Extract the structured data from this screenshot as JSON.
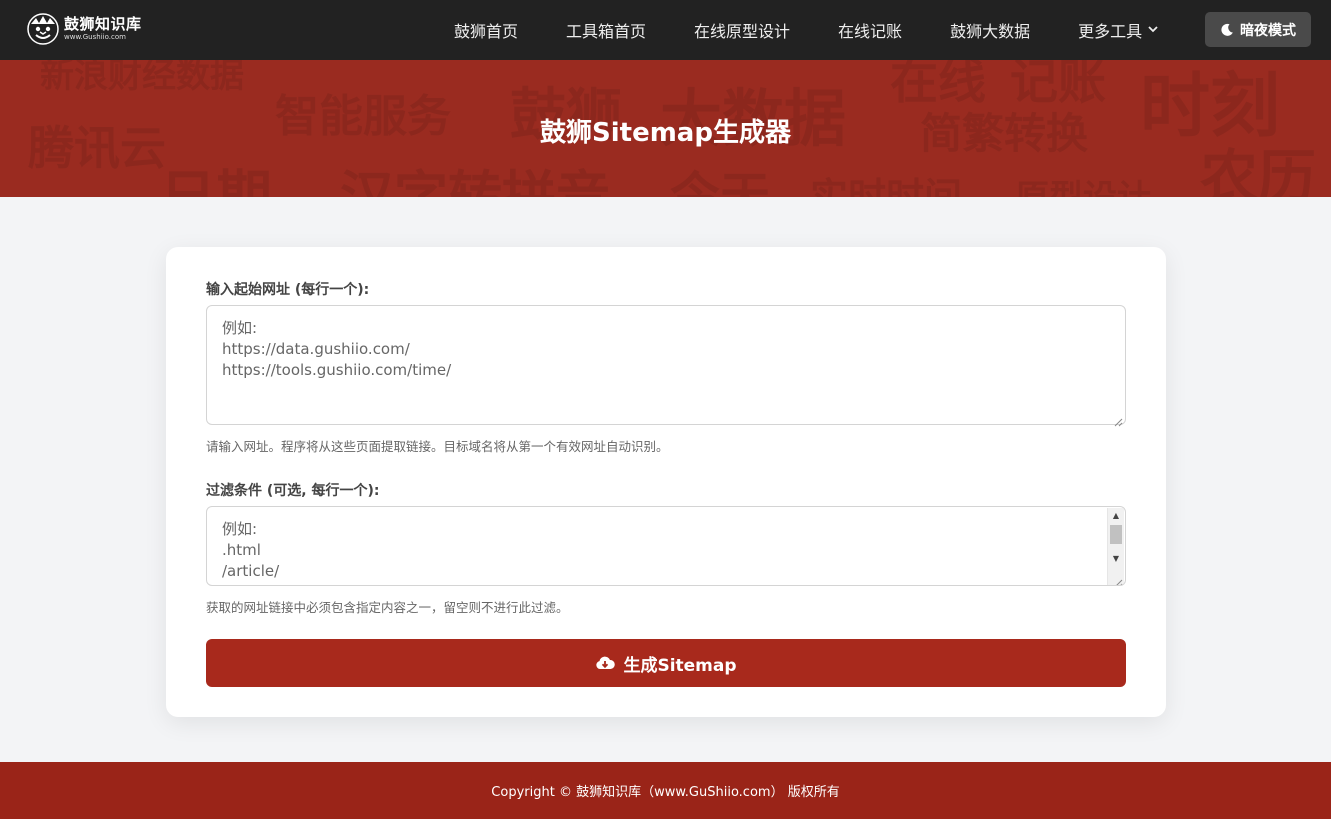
{
  "brand": {
    "name": "鼓狮知识库",
    "url": "www.Gushiio.com"
  },
  "nav": {
    "items": [
      {
        "label": "鼓狮首页"
      },
      {
        "label": "工具箱首页"
      },
      {
        "label": "在线原型设计"
      },
      {
        "label": "在线记账"
      },
      {
        "label": "鼓狮大数据"
      },
      {
        "label": "更多工具"
      }
    ],
    "dark_mode_label": "暗夜模式"
  },
  "banner": {
    "title": "鼓狮Sitemap生成器",
    "bg_words": [
      "新浪财经数据",
      "智能服务",
      "鼓狮",
      "大数据",
      "在线",
      "记账",
      "时刻",
      "腾讯云",
      "简繁转换",
      "日期",
      "汉字转拼音",
      "今天",
      "实时时间",
      "原型设计",
      "农历"
    ]
  },
  "form": {
    "start_urls": {
      "label": "输入起始网址 (每行一个):",
      "placeholder_lines": [
        "例如:",
        "https://data.gushiio.com/",
        "https://tools.gushiio.com/time/"
      ],
      "help": "请输入网址。程序将从这些页面提取链接。目标域名将从第一个有效网址自动识别。"
    },
    "filters": {
      "label": "过滤条件 (可选, 每行一个):",
      "placeholder_lines": [
        "例如:",
        ".html",
        "/article/"
      ],
      "help": "获取的网址链接中必须包含指定内容之一，留空则不进行此过滤。"
    },
    "generate_label": "生成Sitemap"
  },
  "footer": {
    "text": "Copyright © 鼓狮知识库（www.GuShiio.com） 版权所有"
  },
  "colors": {
    "nav_bg": "#222222",
    "banner_bg": "#9a2b20",
    "primary": "#a8291c",
    "footer_bg": "#9a2418",
    "page_bg": "#f3f4f6"
  }
}
